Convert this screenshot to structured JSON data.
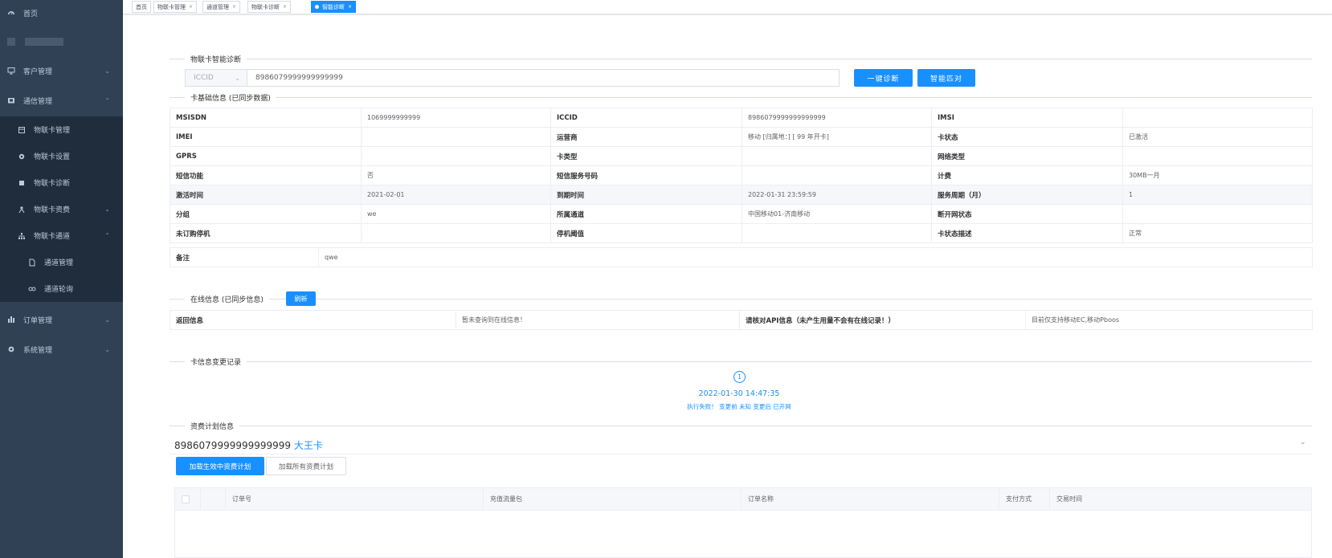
{
  "sidebar": {
    "items": [
      {
        "label": "首页",
        "icon": "dashboard-icon"
      },
      {
        "label": "",
        "icon": "avatar-icon"
      },
      {
        "label": "客户管理",
        "icon": "monitor-icon"
      },
      {
        "label": "通信管理",
        "icon": "card-icon"
      },
      {
        "label": "物联卡管理",
        "icon": "list-icon"
      },
      {
        "label": "物联卡设置",
        "icon": "gear-icon"
      },
      {
        "label": "物联卡诊断",
        "icon": "chip-icon"
      },
      {
        "label": "物联卡资费",
        "icon": "user-icon"
      },
      {
        "label": "物联卡通道",
        "icon": "tree-icon"
      },
      {
        "label": "通道管理",
        "icon": "doc-icon"
      },
      {
        "label": "通道轮询",
        "icon": "link-icon"
      },
      {
        "label": "订单管理",
        "icon": "bar-chart-icon"
      },
      {
        "label": "系统管理",
        "icon": "gear-icon"
      }
    ]
  },
  "tabs": [
    {
      "label": "首页"
    },
    {
      "label": "物联卡管理"
    },
    {
      "label": "通道管理"
    },
    {
      "label": "物联卡诊断"
    },
    {
      "label": "智能诊断"
    }
  ],
  "diagnosis": {
    "section_label": "物联卡智能诊断",
    "select_value": "ICCID",
    "input_value": "8986079999999999999",
    "btn_diagnose": "一键诊断",
    "btn_match": "智能匹对"
  },
  "basic": {
    "section_label": "卡基础信息 (已同步数据)",
    "rows": [
      [
        "MSISDN",
        "1069999999999",
        "ICCID",
        "8986079999999999999",
        "IMSI",
        ""
      ],
      [
        "IMEI",
        "",
        "运营商",
        "移动 [归属地：] [ 99 年开卡]",
        "卡状态",
        "已激活"
      ],
      [
        "GPRS",
        "",
        "卡类型",
        "",
        "网络类型",
        ""
      ],
      [
        "短信功能",
        "否",
        "短信服务号码",
        "",
        "计费",
        "30MB一月"
      ],
      [
        "激活时间",
        "2021-02-01",
        "到期时间",
        "2022-01-31 23:59:59",
        "服务周期（月）",
        "1"
      ],
      [
        "分组",
        "we",
        "所属通道",
        "中国移动01-济南移动",
        "断开网状态",
        ""
      ],
      [
        "未订购停机",
        "",
        "停机阈值",
        "",
        "卡状态描述",
        "正常"
      ]
    ],
    "remark_key": "备注",
    "remark_value": "qwe"
  },
  "online": {
    "section_label": "在线信息 (已同步信息)",
    "refresh_btn": "刷新",
    "row": [
      "返回信息",
      "暂未查询到在线信息！",
      "请核对API信息（未产生用量不会有在线记录！）",
      "目前仅支持移动EC,移动Pboos"
    ]
  },
  "changes": {
    "section_label": "卡信息变更记录",
    "step_number": "1",
    "time": "2022-01-30 14:47:35",
    "desc": "执行失败！ 变更前 未知 变更后 已开网"
  },
  "plan": {
    "section_label": "资费计划信息",
    "iccid": "8986079999999999999",
    "plan_name": "大王卡",
    "btn_active": "加载生效中资费计划",
    "btn_all": "加载所有资费计划",
    "columns": [
      "",
      "",
      "订单号",
      "充值流量包",
      "订单名称",
      "支付方式",
      "交易时间"
    ]
  }
}
